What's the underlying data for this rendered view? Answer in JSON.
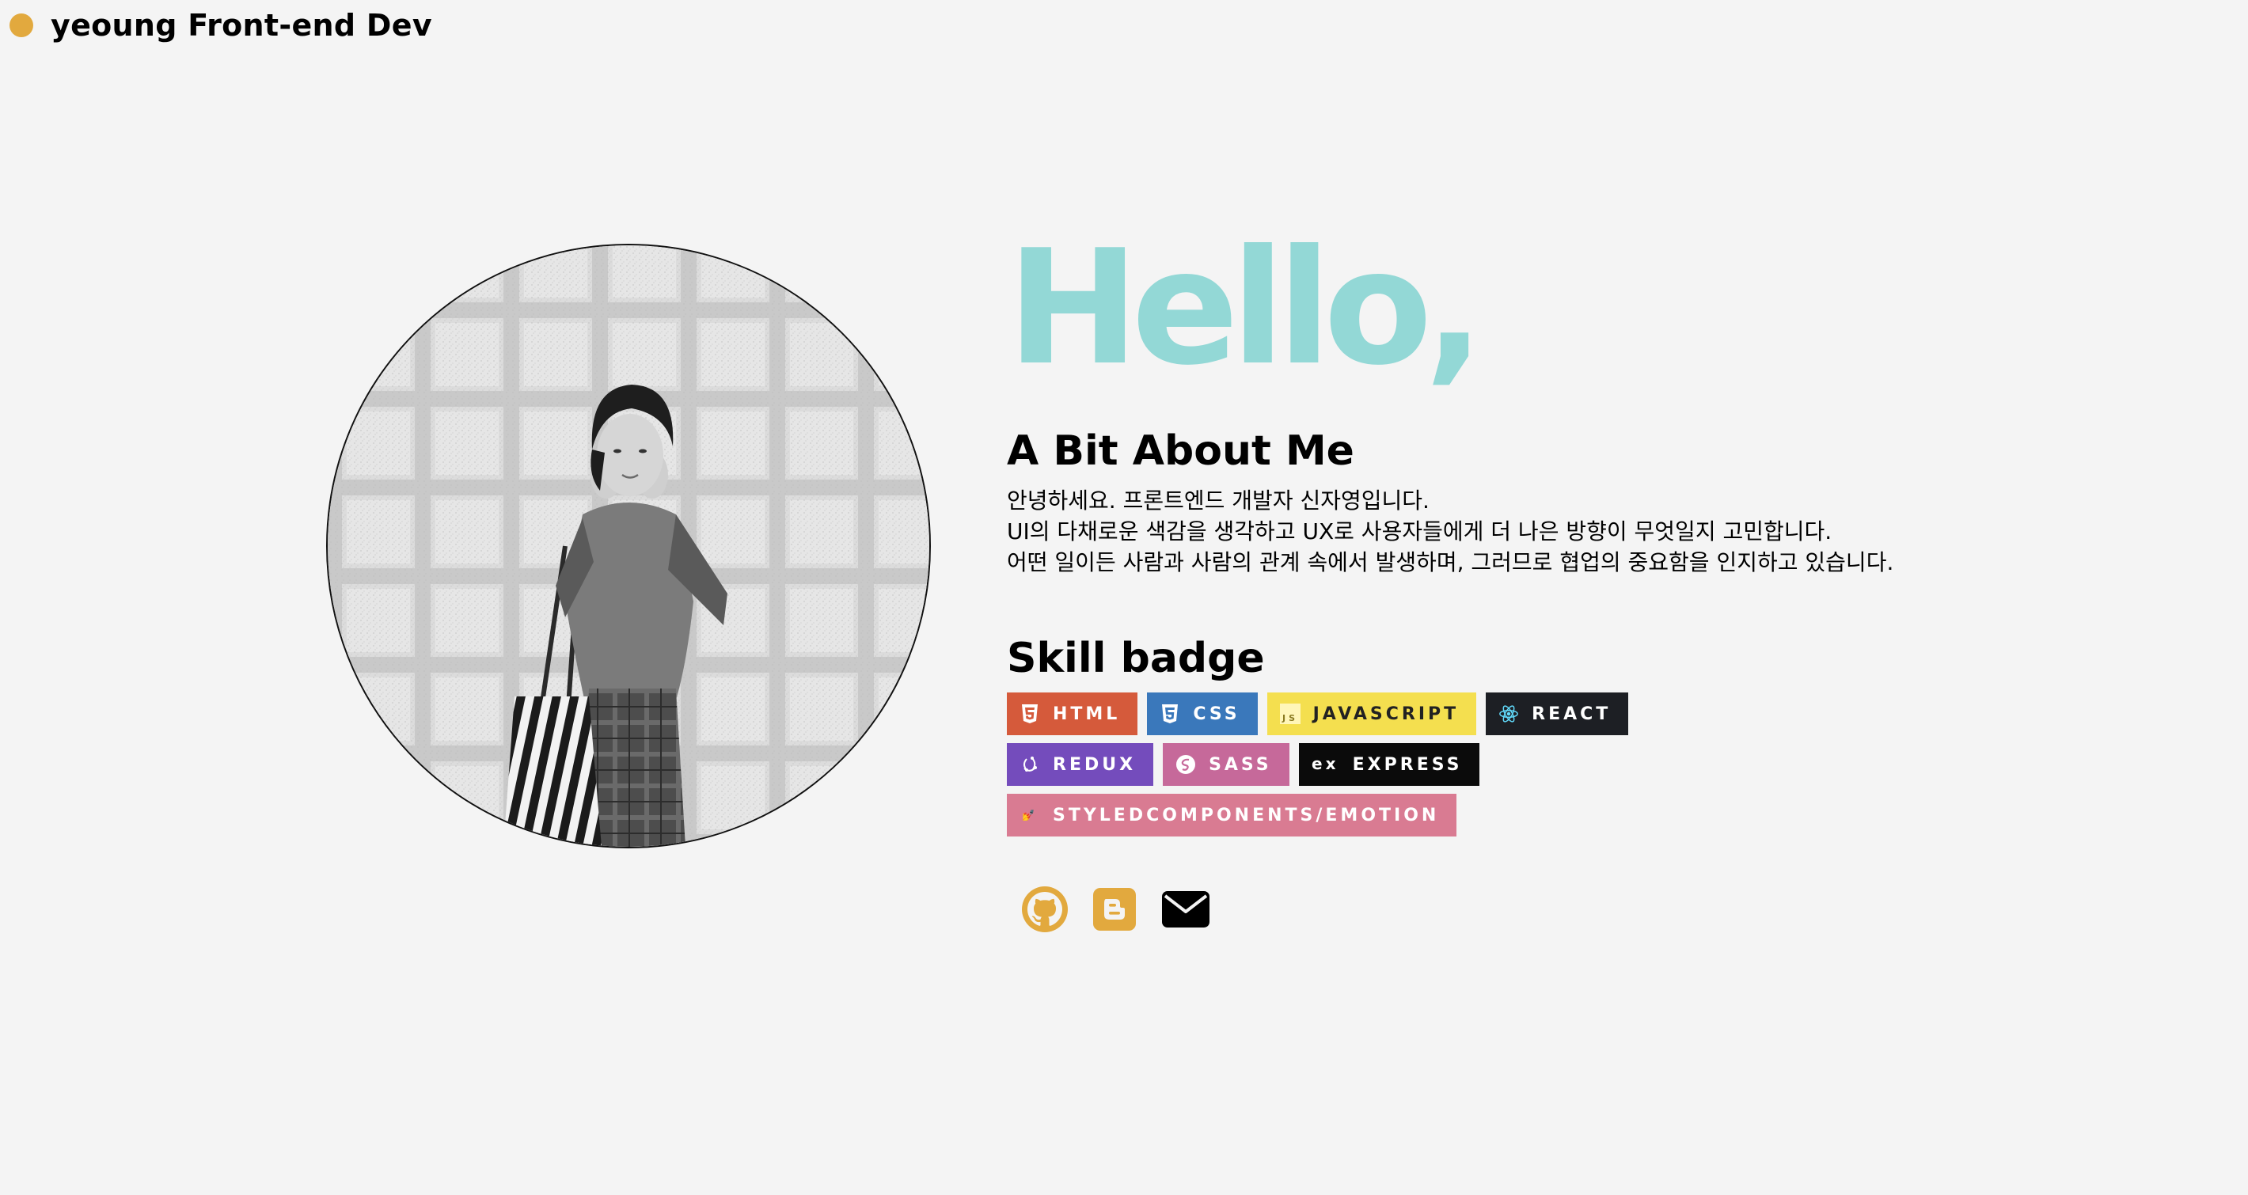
{
  "header": {
    "title": "yeoung Front-end Dev"
  },
  "hero": {
    "greeting": "Hello,"
  },
  "about": {
    "title": "A Bit About Me",
    "lines": [
      "안녕하세요. 프론트엔드 개발자 신자영입니다.",
      "UI의 다채로운 색감을 생각하고 UX로 사용자들에게 더 나은 방향이 무엇일지 고민합니다.",
      "어떤 일이든 사람과 사람의 관계 속에서 발생하며, 그러므로 협업의 중요함을 인지하고 있습니다."
    ]
  },
  "skills": {
    "title": "Skill badge",
    "badges": [
      {
        "label": "HTML",
        "icon": "html5-icon",
        "color": "#d55a3b"
      },
      {
        "label": "CSS",
        "icon": "css3-icon",
        "color": "#3a78bb"
      },
      {
        "label": "JAVASCRIPT",
        "icon": "javascript-icon",
        "color": "#f4df4f"
      },
      {
        "label": "REACT",
        "icon": "react-icon",
        "color": "#1d1f24"
      },
      {
        "label": "REDUX",
        "icon": "redux-icon",
        "color": "#744cbc"
      },
      {
        "label": "SASS",
        "icon": "sass-icon",
        "color": "#c6699a"
      },
      {
        "label": "EXPRESS",
        "icon": "express-icon",
        "color": "#0b0b0b"
      },
      {
        "label": "STYLEDCOMPONENTS/EMOTION",
        "icon": "styled-components-icon",
        "color": "#d97b92"
      }
    ]
  },
  "socials": [
    {
      "icon": "github-icon",
      "color": "#e2a93e"
    },
    {
      "icon": "blogger-icon",
      "color": "#e2a93e"
    },
    {
      "icon": "mail-icon",
      "color": "#000000"
    }
  ],
  "colors": {
    "accent": "#e2a93e",
    "hello": "#93d8d6",
    "background": "#f4f4f4"
  }
}
